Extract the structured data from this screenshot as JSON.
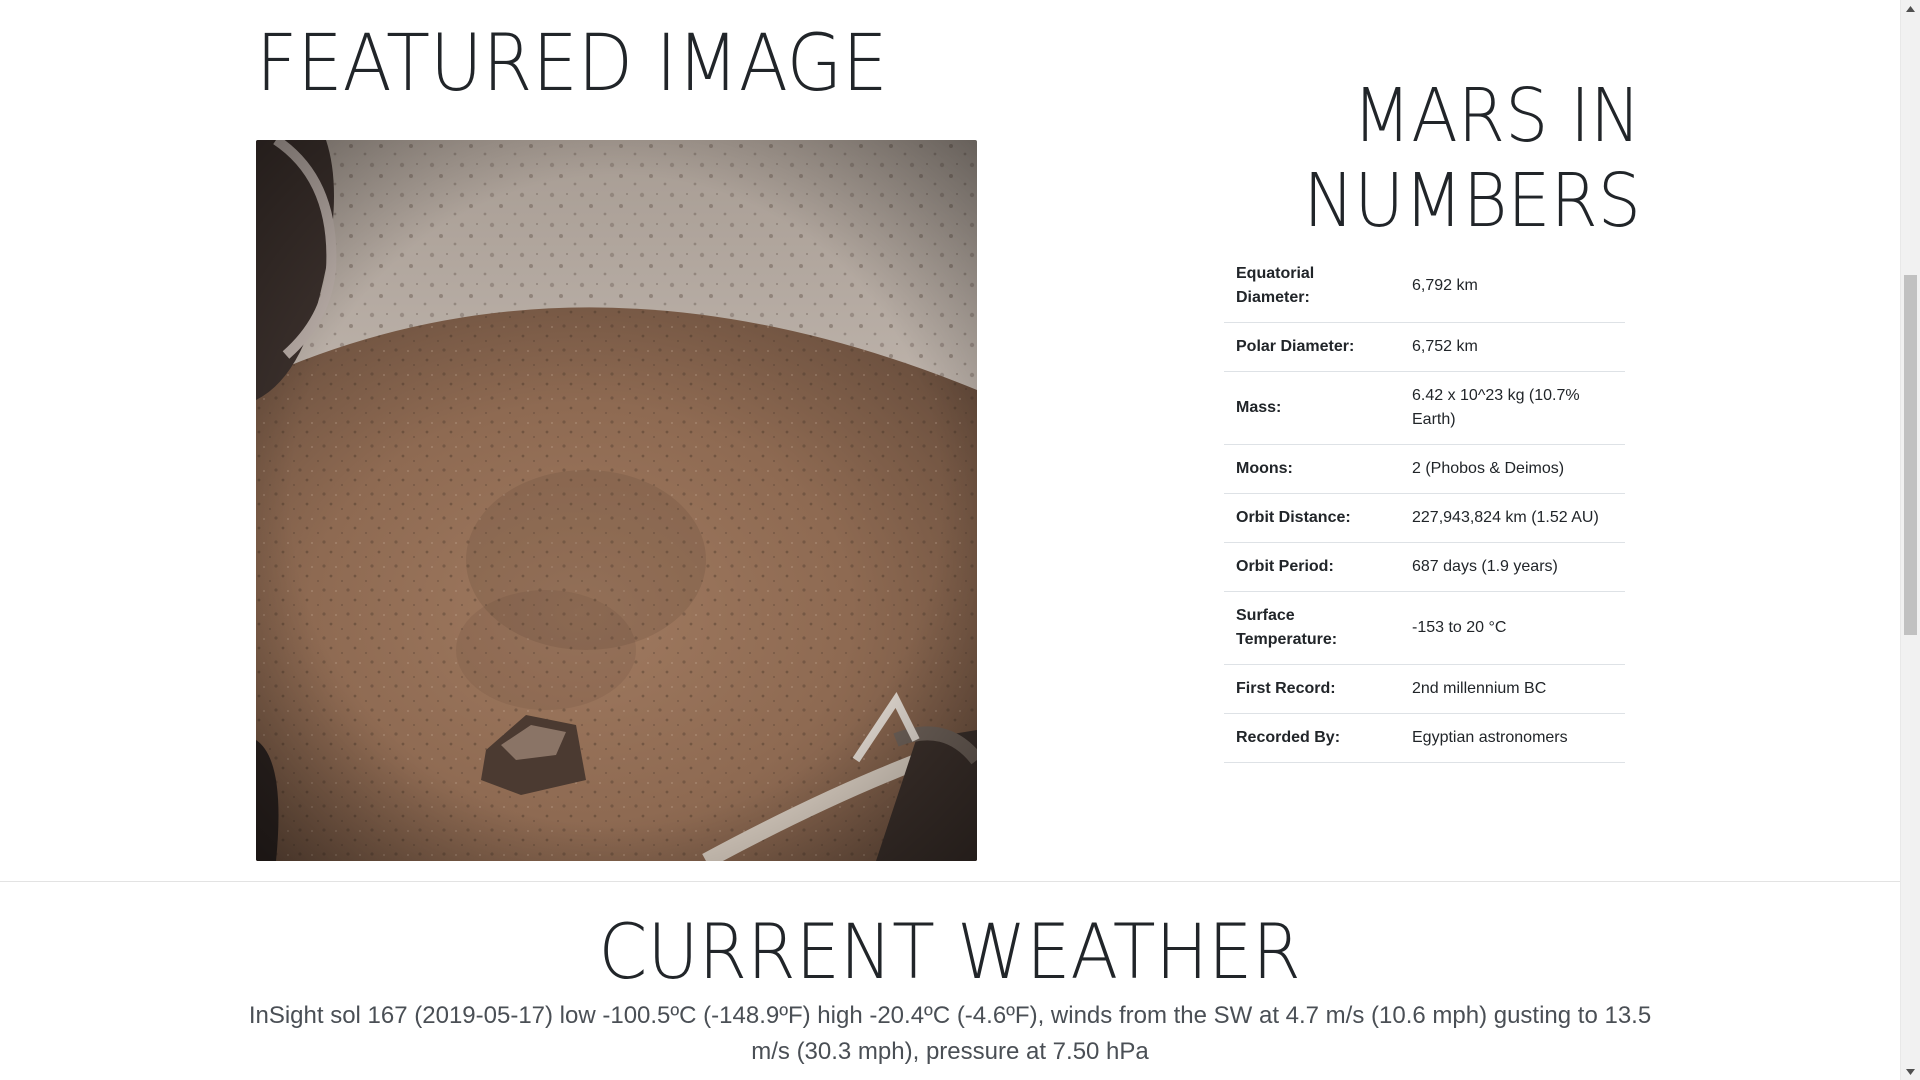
{
  "featured": {
    "title": "FEATURED IMAGE",
    "image_alt": "Mars surface photo from InSight lander"
  },
  "facts": {
    "title_line1": "MARS IN",
    "title_line2": "NUMBERS",
    "rows": [
      {
        "label": "Equatorial Diameter:",
        "value": "6,792 km"
      },
      {
        "label": "Polar Diameter:",
        "value": "6,752 km"
      },
      {
        "label": "Mass:",
        "value": "6.42 x 10^23 kg (10.7% Earth)"
      },
      {
        "label": "Moons:",
        "value": "2 (Phobos & Deimos)"
      },
      {
        "label": "Orbit Distance:",
        "value": "227,943,824 km (1.52 AU)"
      },
      {
        "label": "Orbit Period:",
        "value": "687 days (1.9 years)"
      },
      {
        "label": "Surface Temperature:",
        "value": "-153 to 20 °C"
      },
      {
        "label": "First Record:",
        "value": "2nd millennium BC"
      },
      {
        "label": "Recorded By:",
        "value": "Egyptian astronomers"
      }
    ]
  },
  "weather": {
    "title": "CURRENT WEATHER",
    "report": "InSight sol 167 (2019-05-17) low -100.5ºC (-148.9ºF) high -20.4ºC (-4.6ºF), winds from the SW at 4.7 m/s (10.6 mph) gusting to 13.5 m/s (30.3 mph), pressure at 7.50 hPa"
  },
  "scrollbar": {
    "up_icon": "arrow-up-icon",
    "down_icon": "arrow-down-icon"
  }
}
